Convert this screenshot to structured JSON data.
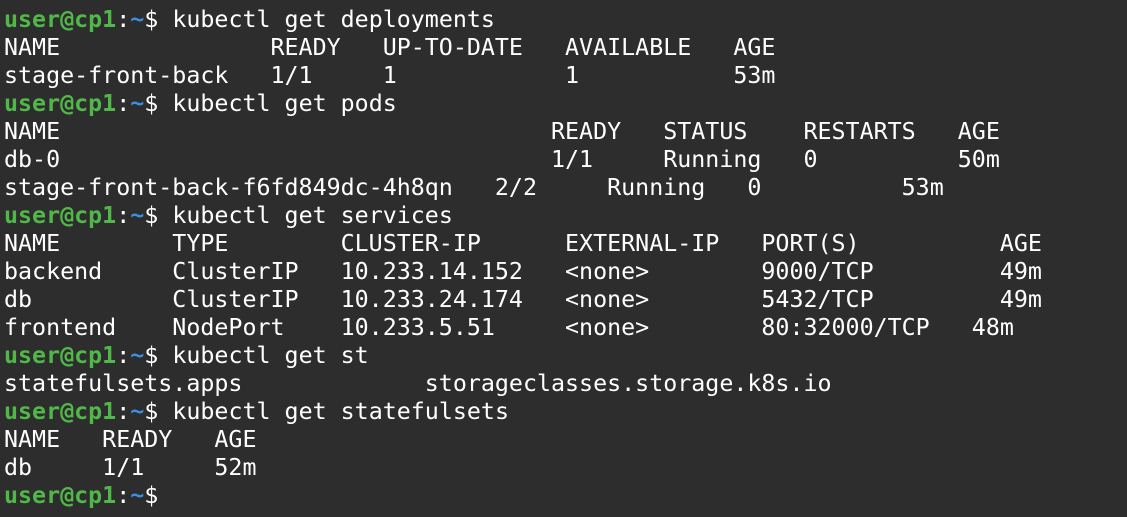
{
  "terminal": {
    "lines": [
      {
        "kind": "prompt",
        "user_host": "user@cp1",
        "sep": ":",
        "path": "~",
        "symbol": "$ ",
        "command": "kubectl get deployments"
      },
      {
        "kind": "output",
        "text": "NAME               READY   UP-TO-DATE   AVAILABLE   AGE"
      },
      {
        "kind": "output",
        "text": "stage-front-back   1/1     1            1           53m"
      },
      {
        "kind": "prompt",
        "user_host": "user@cp1",
        "sep": ":",
        "path": "~",
        "symbol": "$ ",
        "command": "kubectl get pods"
      },
      {
        "kind": "output",
        "text": "NAME                                   READY   STATUS    RESTARTS   AGE"
      },
      {
        "kind": "output",
        "text": "db-0                                   1/1     Running   0          50m"
      },
      {
        "kind": "output",
        "text": "stage-front-back-f6fd849dc-4h8qn   2/2     Running   0          53m"
      },
      {
        "kind": "prompt",
        "user_host": "user@cp1",
        "sep": ":",
        "path": "~",
        "symbol": "$ ",
        "command": "kubectl get services"
      },
      {
        "kind": "output",
        "text": "NAME        TYPE        CLUSTER-IP      EXTERNAL-IP   PORT(S)          AGE"
      },
      {
        "kind": "output",
        "text": "backend     ClusterIP   10.233.14.152   <none>        9000/TCP         49m"
      },
      {
        "kind": "output",
        "text": "db          ClusterIP   10.233.24.174   <none>        5432/TCP         49m"
      },
      {
        "kind": "output",
        "text": "frontend    NodePort    10.233.5.51     <none>        80:32000/TCP   48m"
      },
      {
        "kind": "prompt",
        "user_host": "user@cp1",
        "sep": ":",
        "path": "~",
        "symbol": "$ ",
        "command": "kubectl get st"
      },
      {
        "kind": "output",
        "text": "statefulsets.apps             storageclasses.storage.k8s.io"
      },
      {
        "kind": "prompt",
        "user_host": "user@cp1",
        "sep": ":",
        "path": "~",
        "symbol": "$ ",
        "command": "kubectl get statefulsets"
      },
      {
        "kind": "output",
        "text": "NAME   READY   AGE"
      },
      {
        "kind": "output",
        "text": "db     1/1     52m"
      },
      {
        "kind": "prompt",
        "user_host": "user@cp1",
        "sep": ":",
        "path": "~",
        "symbol": "$",
        "command": ""
      }
    ]
  },
  "colors": {
    "background": "#2d2d2d",
    "text": "#ffffff",
    "user_host": "#50b848",
    "path": "#3b8ee6"
  }
}
